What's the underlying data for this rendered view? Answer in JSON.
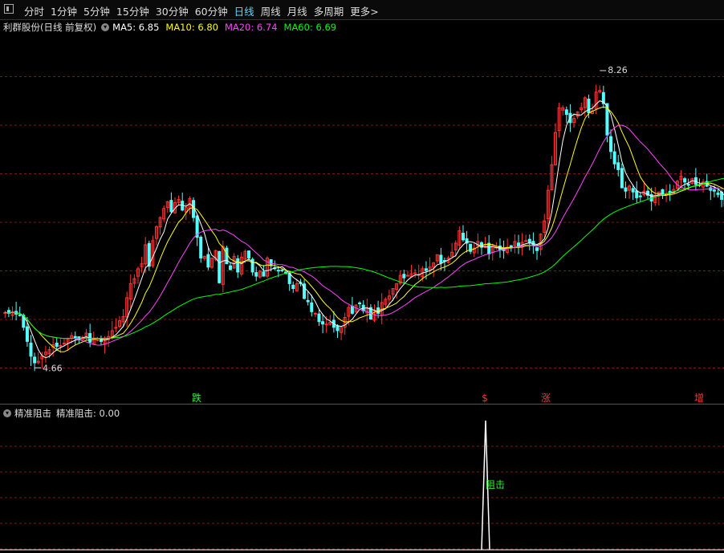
{
  "toolbar": {
    "icon": "panel-icon",
    "tabs": [
      {
        "label": "分时",
        "active": false
      },
      {
        "label": "1分钟",
        "active": false
      },
      {
        "label": "5分钟",
        "active": false
      },
      {
        "label": "15分钟",
        "active": false
      },
      {
        "label": "30分钟",
        "active": false
      },
      {
        "label": "60分钟",
        "active": false
      },
      {
        "label": "日线",
        "active": true
      },
      {
        "label": "周线",
        "active": false
      },
      {
        "label": "月线",
        "active": false
      },
      {
        "label": "多周期",
        "active": false
      },
      {
        "label": "更多>",
        "active": false
      }
    ]
  },
  "legend": {
    "stock_name": "利群股份(日线 前复权)",
    "ma": [
      {
        "label": "MA5: 6.85",
        "color": "#ffffff"
      },
      {
        "label": "MA10: 6.80",
        "color": "#ffff00"
      },
      {
        "label": "MA20: 6.74",
        "color": "#ff44ff"
      },
      {
        "label": "MA60: 6.69",
        "color": "#00ff00"
      }
    ]
  },
  "price_labels": {
    "high": "8.26",
    "low": "4.66"
  },
  "signals": [
    {
      "text": "跌",
      "color": "#33ee33"
    },
    {
      "text": "$",
      "color": "#ff3333"
    },
    {
      "text": "涨",
      "color": "#ff3333"
    },
    {
      "text": "增",
      "color": "#ff3333"
    }
  ],
  "sub_legend": {
    "title": "精准阻击",
    "value_label": "精准阻击: 0.00"
  },
  "sub_annotation": "阻击",
  "colors": {
    "up": "#ff3333",
    "down": "#54ffff",
    "grid": "#7a1a1a",
    "ma5": "#ffffff",
    "ma10": "#ffff00",
    "ma20": "#ff44ff",
    "ma60": "#00ff00"
  },
  "chart_data": {
    "type": "candlestick",
    "ylim": [
      4.4,
      8.6
    ],
    "closes": [
      5.33,
      5.32,
      5.34,
      5.31,
      5.3,
      5.15,
      4.98,
      4.8,
      4.72,
      4.74,
      4.8,
      4.85,
      4.88,
      4.94,
      4.92,
      4.93,
      4.96,
      5.01,
      5.05,
      5.02,
      5.0,
      5.03,
      5.08,
      4.97,
      5.01,
      5.0,
      4.98,
      5.02,
      5.04,
      5.11,
      5.15,
      5.23,
      5.28,
      5.51,
      5.68,
      5.74,
      5.86,
      5.92,
      6.15,
      5.89,
      6.2,
      6.37,
      6.48,
      6.59,
      6.67,
      6.55,
      6.66,
      6.7,
      6.57,
      6.6,
      6.71,
      6.48,
      6.24,
      5.99,
      6.01,
      5.88,
      5.99,
      6.08,
      5.69,
      6.13,
      5.92,
      5.85,
      6.01,
      5.82,
      6.0,
      6.07,
      5.99,
      5.82,
      5.77,
      5.83,
      5.77,
      5.99,
      5.9,
      5.86,
      5.84,
      5.84,
      5.8,
      5.68,
      5.62,
      5.68,
      5.68,
      5.5,
      5.46,
      5.34,
      5.32,
      5.22,
      5.19,
      5.19,
      5.21,
      5.15,
      5.11,
      5.15,
      5.27,
      5.39,
      5.32,
      5.42,
      5.44,
      5.35,
      5.39,
      5.25,
      5.36,
      5.32,
      5.45,
      5.49,
      5.53,
      5.62,
      5.68,
      5.78,
      5.75,
      5.78,
      5.8,
      5.81,
      5.79,
      5.86,
      5.84,
      5.88,
      5.93,
      6.03,
      5.93,
      5.95,
      5.99,
      6.06,
      6.17,
      6.32,
      6.21,
      6.17,
      6.07,
      6.11,
      6.19,
      6.12,
      6.15,
      6.04,
      6.14,
      6.13,
      6.09,
      6.08,
      6.12,
      6.12,
      6.19,
      6.13,
      6.18,
      6.2,
      6.17,
      6.14,
      6.08,
      6.28,
      6.44,
      6.81,
      7.12,
      7.51,
      7.81,
      7.81,
      7.73,
      7.63,
      7.68,
      7.76,
      7.81,
      7.93,
      7.75,
      7.77,
      8.0,
      8.02,
      7.86,
      7.48,
      7.28,
      7.13,
      7.06,
      6.84,
      6.8,
      6.86,
      6.79,
      6.72,
      6.74,
      6.8,
      6.75,
      6.68,
      6.75,
      6.79,
      6.76,
      6.77,
      6.78,
      6.82,
      6.92,
      6.98,
      6.91,
      6.87,
      6.95,
      6.88,
      6.87,
      6.91,
      6.86,
      6.81,
      6.8,
      6.76,
      6.7,
      6.62
    ],
    "series": [
      {
        "name": "MA5",
        "values": []
      },
      {
        "name": "MA10",
        "values": []
      },
      {
        "name": "MA20",
        "values": []
      },
      {
        "name": "MA60",
        "values": []
      }
    ],
    "indicator": {
      "name": "精准阻击",
      "spike_index": 147,
      "spike_value": 1.0,
      "ylim": [
        0,
        1.0
      ]
    }
  }
}
